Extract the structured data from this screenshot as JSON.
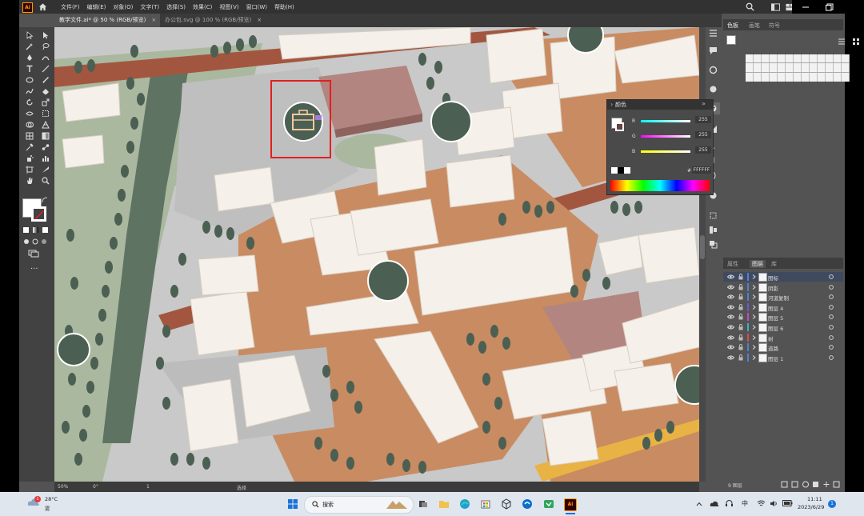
{
  "app": {
    "logo": "Ai"
  },
  "menu": [
    "文件(F)",
    "编辑(E)",
    "对象(O)",
    "文字(T)",
    "选择(S)",
    "效果(C)",
    "视图(V)",
    "窗口(W)",
    "帮助(H)"
  ],
  "tabs": [
    {
      "label": "教学文件.ai* @ 50 % (RGB/预览)",
      "active": true
    },
    {
      "label": "办公包.svg @ 100 % (RGB/预览)",
      "active": false
    }
  ],
  "status": {
    "zoom": "50%",
    "rotation": "0°",
    "page": "1",
    "tool": "选择"
  },
  "panel_tabs_top": [
    "色板",
    "画笔",
    "符号"
  ],
  "panel_tabs_bottom": [
    "属性",
    "图层",
    "库"
  ],
  "color_panel": {
    "title": "颜色",
    "r": "255",
    "g": "255",
    "b": "255",
    "hex": "FFFFFF"
  },
  "layers": {
    "items": [
      {
        "name": "图标",
        "color": "#4f7fd6",
        "selected": true
      },
      {
        "name": "阴影",
        "color": "#4f7fd6",
        "selected": false
      },
      {
        "name": "河道复制",
        "color": "#4f7fd6",
        "selected": false
      },
      {
        "name": "图层 4",
        "color": "#6a5acd",
        "selected": false
      },
      {
        "name": "图层 5",
        "color": "#c04dc0",
        "selected": false
      },
      {
        "name": "图层 6",
        "color": "#3ab0c8",
        "selected": false
      },
      {
        "name": "树",
        "color": "#e04848",
        "selected": false
      },
      {
        "name": "道路",
        "color": "#4f7fd6",
        "selected": false
      },
      {
        "name": "图层 1",
        "color": "#4f7fd6",
        "selected": false
      }
    ],
    "count_label": "9 图层"
  },
  "taskbar": {
    "weather_temp": "28°C",
    "weather_desc": "雾",
    "weather_badge": "1",
    "search_label": "搜索",
    "ime": "中",
    "time": "11:11",
    "date": "2023/6/29",
    "notif_count": "1"
  },
  "colors": {
    "plaza_brown": "#c98b61",
    "road_dark": "#a3563f",
    "green_bg": "#aab89f",
    "tree_dark": "#4b5f52",
    "building_top": "#f5f0ea",
    "building_side": "#ddd2c6",
    "mauve": "#b38580",
    "selection_red": "#e02020"
  }
}
